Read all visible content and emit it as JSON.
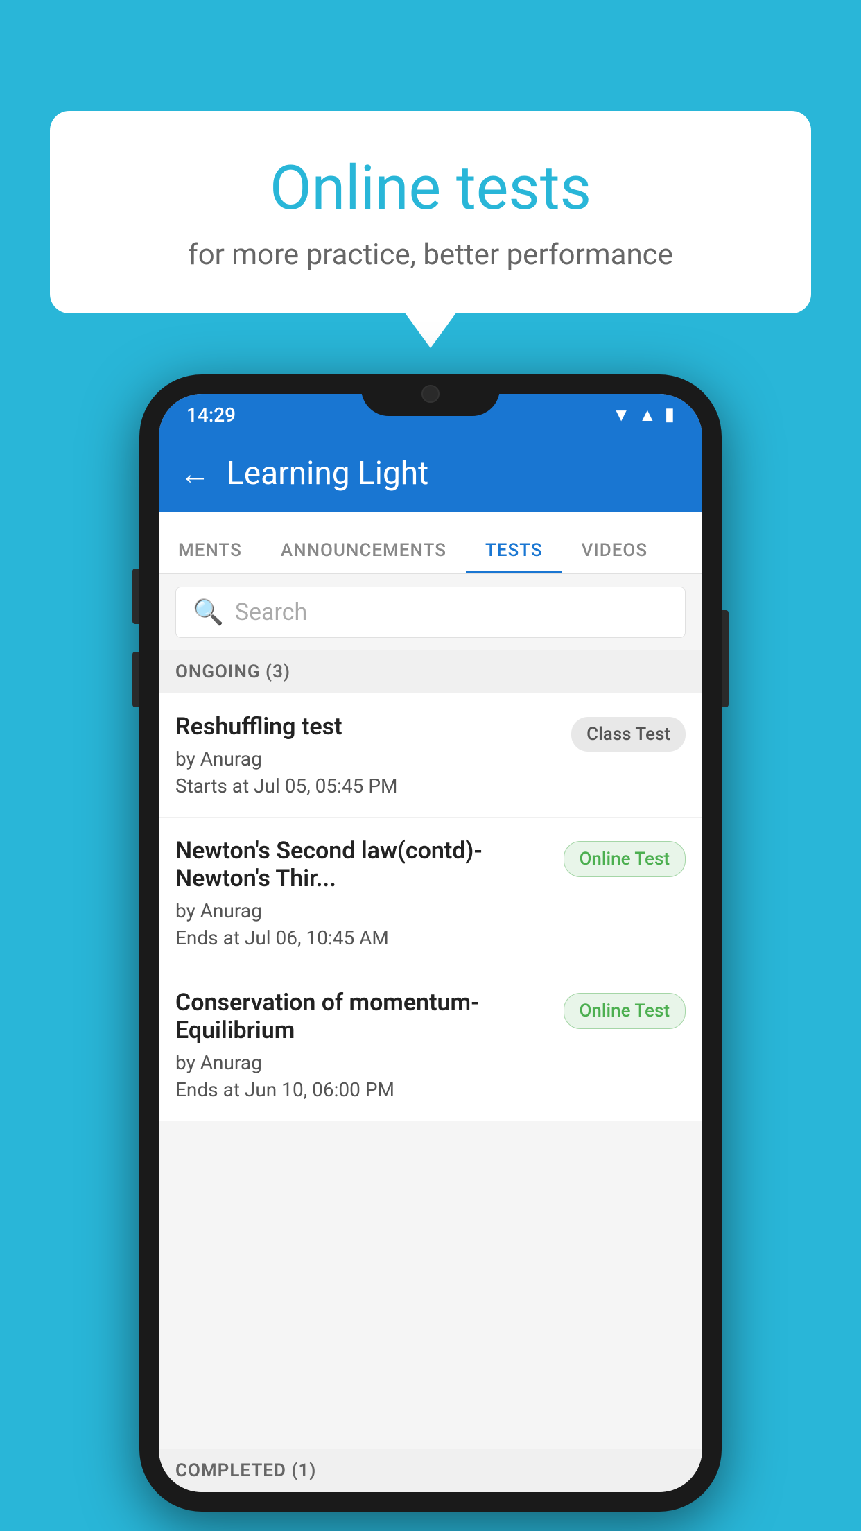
{
  "background": {
    "color": "#29b6d8"
  },
  "speech_bubble": {
    "title": "Online tests",
    "subtitle": "for more practice, better performance"
  },
  "phone": {
    "status_bar": {
      "time": "14:29",
      "icons": [
        "wifi",
        "signal",
        "battery"
      ]
    },
    "app_bar": {
      "title": "Learning Light",
      "back_label": "←"
    },
    "tabs": [
      {
        "label": "MENTS",
        "active": false
      },
      {
        "label": "ANNOUNCEMENTS",
        "active": false
      },
      {
        "label": "TESTS",
        "active": true
      },
      {
        "label": "VIDEOS",
        "active": false
      }
    ],
    "search": {
      "placeholder": "Search"
    },
    "section_ongoing": {
      "label": "ONGOING (3)"
    },
    "tests": [
      {
        "name": "Reshuffling test",
        "author": "by Anurag",
        "time_label": "Starts at",
        "time_value": "Jul 05, 05:45 PM",
        "badge": "Class Test",
        "badge_type": "class"
      },
      {
        "name": "Newton's Second law(contd)-Newton's Thir...",
        "author": "by Anurag",
        "time_label": "Ends at",
        "time_value": "Jul 06, 10:45 AM",
        "badge": "Online Test",
        "badge_type": "online"
      },
      {
        "name": "Conservation of momentum-Equilibrium",
        "author": "by Anurag",
        "time_label": "Ends at",
        "time_value": "Jun 10, 06:00 PM",
        "badge": "Online Test",
        "badge_type": "online"
      }
    ],
    "section_completed": {
      "label": "COMPLETED (1)"
    }
  }
}
